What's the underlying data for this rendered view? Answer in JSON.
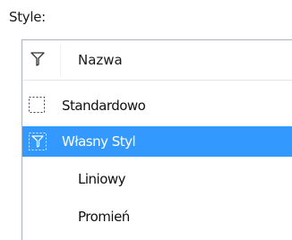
{
  "style_label": "Style:",
  "list": {
    "header": {
      "column_name": "Nazwa",
      "filter_icon": "filter-icon"
    },
    "rows": [
      {
        "label": "Standardowo",
        "icon": "dashed-box-icon",
        "selected": false,
        "level": 0
      },
      {
        "label": "Własny Styl",
        "icon": "filter-box-icon",
        "selected": true,
        "level": 0
      },
      {
        "label": "Liniowy",
        "icon": null,
        "selected": false,
        "level": 1
      },
      {
        "label": "Promień",
        "icon": null,
        "selected": false,
        "level": 1
      }
    ]
  },
  "colors": {
    "selection": "#3399ff",
    "border": "#a9b4c2"
  }
}
